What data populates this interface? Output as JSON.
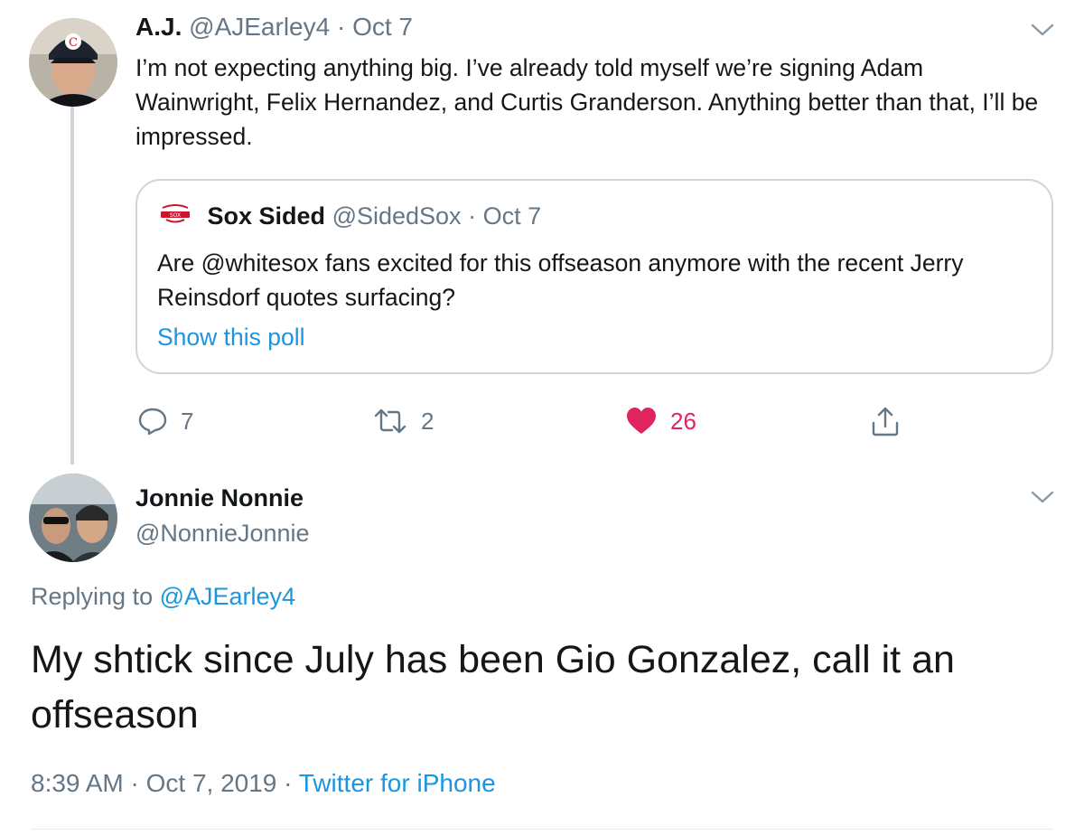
{
  "tweet1": {
    "display_name": "A.J.",
    "handle": "@AJEarley4",
    "separator": "·",
    "date": "Oct 7",
    "text": "I’m not expecting anything big. I’ve already told myself we’re signing Adam Wainwright, Felix Hernandez, and Curtis Granderson. Anything better than that, I’ll be impressed.",
    "quote": {
      "display_name": "Sox Sided",
      "handle": "@SidedSox",
      "separator": "·",
      "date": "Oct 7",
      "text": "Are @whitesox fans excited for this offseason anymore with the recent Jerry Reinsdorf quotes surfacing?",
      "link": "Show this poll"
    },
    "actions": {
      "reply_count": "7",
      "retweet_count": "2",
      "like_count": "26"
    }
  },
  "tweet2": {
    "display_name": "Jonnie Nonnie",
    "handle": "@NonnieJonnie",
    "replying_prefix": "Replying to",
    "replying_handle": "@AJEarley4",
    "text": "My shtick since July has been Gio Gonzalez, call it an offseason",
    "time": "8:39 AM",
    "separator1": "·",
    "date": "Oct 7, 2019",
    "separator2": "·",
    "source": "Twitter for iPhone"
  },
  "colors": {
    "accent": "#1b95e0",
    "like": "#e0245e",
    "secondary_text": "#657786",
    "border": "#ccd6dd"
  },
  "icons": [
    "chevron-down-icon",
    "reply-icon",
    "retweet-icon",
    "heart-icon",
    "share-icon",
    "sox-sided-logo-icon"
  ]
}
